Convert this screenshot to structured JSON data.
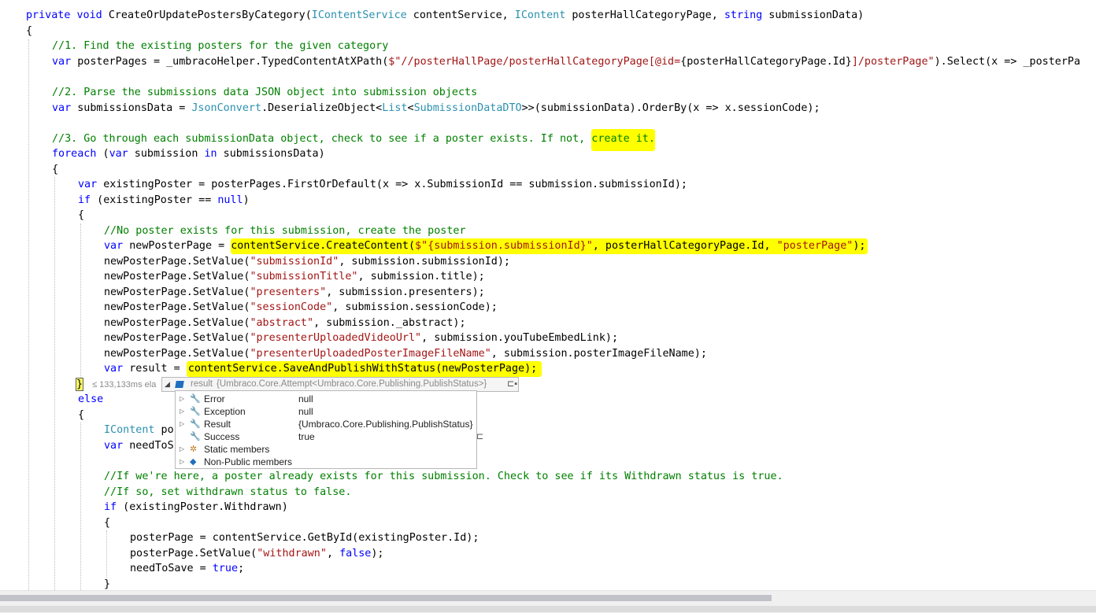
{
  "code": {
    "l1": {
      "a": "private",
      "b": "void",
      "c": "CreateOrUpdatePostersByCategory(",
      "d": "IContentService",
      "e": " contentService, ",
      "f": "IContent",
      "g": " posterHallCategoryPage, ",
      "h": "string",
      "i": " submissionData)"
    },
    "l2": "{",
    "l3": "//1. Find the existing posters for the given category",
    "l4": {
      "a": "var",
      "b": " posterPages = _umbracoHelper.TypedContentAtXPath(",
      "c": "$\"//posterHallPage/posterHallCategoryPage[@id=",
      "d": "{posterHallCategoryPage.Id}",
      "e": "]/posterPage\"",
      "f": ").Select(x => _posterPa"
    },
    "l6": "//2. Parse the submissions data JSON object into submission objects",
    "l7": {
      "a": "var",
      "b": " submissionsData = ",
      "c": "JsonConvert",
      "d": ".DeserializeObject<",
      "e": "List",
      "f": "<",
      "g": "SubmissionDataDTO",
      "h": ">>(submissionData).OrderBy(x => x.sessionCode);"
    },
    "l9": {
      "a": "//3. Go through each submissionData object, check to see if a poster exists. If not, ",
      "b": "create it."
    },
    "l10": {
      "a": "foreach",
      "b": " (",
      "c": "var",
      "d": " submission ",
      "e": "in",
      "f": " submissionsData)"
    },
    "l11": "{",
    "l12": {
      "a": "var",
      "b": " existingPoster = posterPages.FirstOrDefault(x => x.SubmissionId == submission.submissionId);"
    },
    "l13": {
      "a": "if",
      "b": " (existingPoster == ",
      "c": "null",
      "d": ")"
    },
    "l14": "{",
    "l15": "//No poster exists for this submission, create the poster",
    "l16": {
      "a": "var",
      "b": " newPosterPage = ",
      "c": "contentService.CreateContent(",
      "d": "$\"{submission.submissionId}\"",
      "e": ", posterHallCategoryPage.Id, ",
      "f": "\"posterPage\"",
      "g": ");"
    },
    "l17": {
      "a": "newPosterPage.SetValue(",
      "b": "\"submissionId\"",
      "c": ", submission.submissionId);"
    },
    "l18": {
      "a": "newPosterPage.SetValue(",
      "b": "\"submissionTitle\"",
      "c": ", submission.title);"
    },
    "l19": {
      "a": "newPosterPage.SetValue(",
      "b": "\"presenters\"",
      "c": ", submission.presenters);"
    },
    "l20": {
      "a": "newPosterPage.SetValue(",
      "b": "\"sessionCode\"",
      "c": ", submission.sessionCode);"
    },
    "l21": {
      "a": "newPosterPage.SetValue(",
      "b": "\"abstract\"",
      "c": ", submission._abstract);"
    },
    "l22": {
      "a": "newPosterPage.SetValue(",
      "b": "\"presenterUploadedVideoUrl\"",
      "c": ", submission.youTubeEmbedLink);"
    },
    "l23": {
      "a": "newPosterPage.SetValue(",
      "b": "\"presenterUploadedPosterImageFileName\"",
      "c": ", submission.posterImageFileName);"
    },
    "l24": {
      "a": "var",
      "b": " result = ",
      "c": "contentService.SaveAndPublishWithStatus(newPosterPage);"
    },
    "l25": {
      "brace": "}",
      "perf": "≤ 133,133ms ela"
    },
    "l26": "else",
    "l27": "{",
    "l28": {
      "a": "IContent",
      "b": " po"
    },
    "l29": {
      "a": "var",
      "b": " needToS"
    },
    "l31": "//If we're here, a poster already exists for this submission. Check to see if its Withdrawn status is true.",
    "l32": "//If so, set withdrawn status to false.",
    "l33": {
      "a": "if",
      "b": " (existingPoster.Withdrawn)"
    },
    "l34": "{",
    "l35": "posterPage = contentService.GetById(existingPoster.Id);",
    "l36": {
      "a": "posterPage.SetValue(",
      "b": "\"withdrawn\"",
      "c": ", ",
      "d": "false",
      "e": ");"
    },
    "l37": {
      "a": "needToSave = ",
      "b": "true",
      "c": ";"
    },
    "l38": "}"
  },
  "datatip": {
    "name": "result",
    "value": "{Umbraco.Core.Attempt<Umbraco.Core.Publishing.PublishStatus>}",
    "members": [
      {
        "name": "Error",
        "value": "null",
        "icon": "wrench-icon"
      },
      {
        "name": "Exception",
        "value": "null",
        "icon": "wrench-icon"
      },
      {
        "name": "Result",
        "value": "{Umbraco.Core.Publishing.PublishStatus}",
        "icon": "wrench-icon"
      },
      {
        "name": "Success",
        "value": "true",
        "icon": "wrench-icon"
      },
      {
        "name": "Static members",
        "value": "",
        "icon": "static-members-icon"
      },
      {
        "name": "Non-Public members",
        "value": "",
        "icon": "object-icon"
      }
    ]
  },
  "colors": {
    "keyword": "#0000ff",
    "type": "#2b91af",
    "string": "#a31515",
    "comment": "#008000",
    "highlight": "#ffff00"
  }
}
